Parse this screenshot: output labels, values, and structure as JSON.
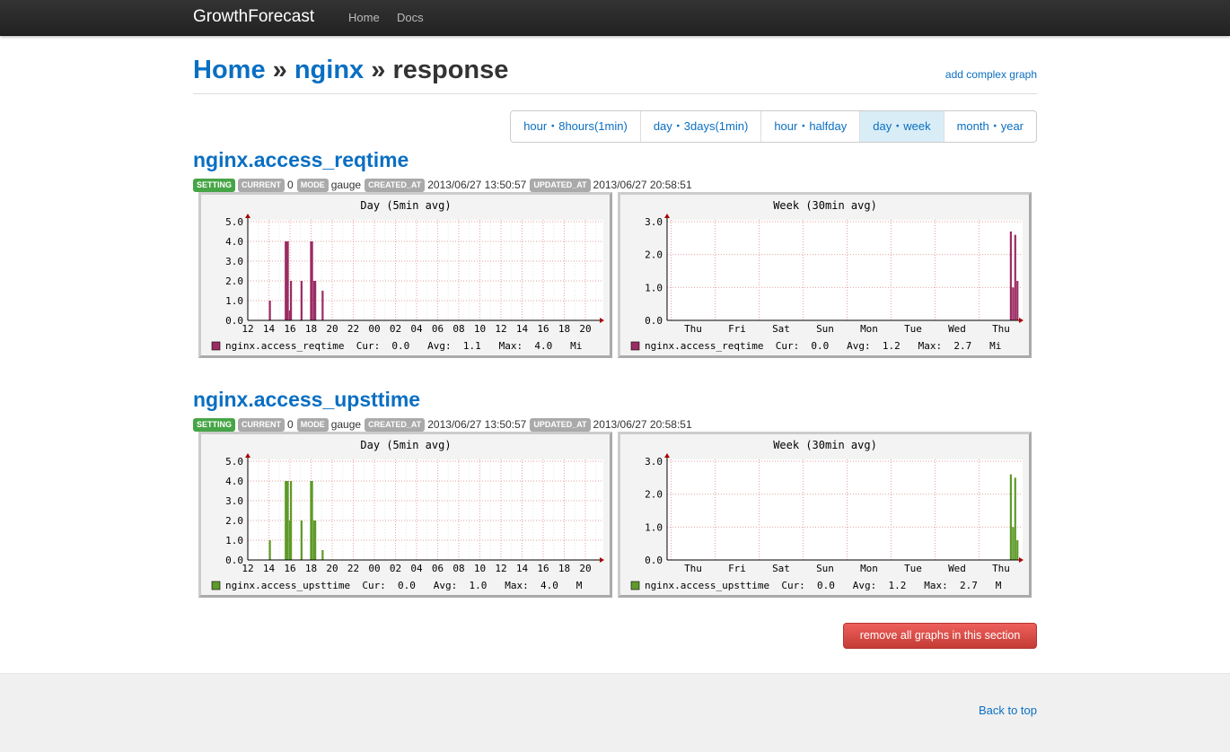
{
  "navbar": {
    "brand": "GrowthForecast",
    "links": [
      "Home",
      "Docs"
    ]
  },
  "header": {
    "crumbs": [
      "Home",
      "nginx",
      "response"
    ],
    "separator": "»",
    "add_link": "add complex graph"
  },
  "period_tabs": [
    {
      "label": "hour・8hours(1min)",
      "active": false
    },
    {
      "label": "day・3days(1min)",
      "active": false
    },
    {
      "label": "hour・halfday",
      "active": false
    },
    {
      "label": "day・week",
      "active": true
    },
    {
      "label": "month・year",
      "active": false
    }
  ],
  "graphs": [
    {
      "title": "nginx.access_reqtime",
      "labels": {
        "setting": "SETTING",
        "current": "CURRENT",
        "mode": "MODE",
        "created": "CREATED_AT",
        "updated": "UPDATED_AT"
      },
      "current": "0",
      "mode": "gauge",
      "created_at": "2013/06/27 13:50:57",
      "updated_at": "2013/06/27 20:58:51",
      "color": "#9b2c63"
    },
    {
      "title": "nginx.access_upsttime",
      "labels": {
        "setting": "SETTING",
        "current": "CURRENT",
        "mode": "MODE",
        "created": "CREATED_AT",
        "updated": "UPDATED_AT"
      },
      "current": "0",
      "mode": "gauge",
      "created_at": "2013/06/27 13:50:57",
      "updated_at": "2013/06/27 20:58:51",
      "color": "#5f9a2a"
    }
  ],
  "chart_data": [
    {
      "type": "area",
      "title": "Day (5min avg)",
      "series": [
        {
          "name": "nginx.access_reqtime"
        }
      ],
      "x_ticks": [
        "12",
        "14",
        "16",
        "18",
        "20",
        "22",
        "00",
        "02",
        "04",
        "06",
        "08",
        "10",
        "12",
        "14",
        "16",
        "18",
        "20"
      ],
      "y_ticks": [
        "0.0",
        "1.0",
        "2.0",
        "3.0",
        "4.0",
        "5.0"
      ],
      "ylim": [
        0,
        5
      ],
      "points": [
        [
          14.0,
          1.0
        ],
        [
          15.5,
          4.0
        ],
        [
          15.6,
          4.0
        ],
        [
          15.7,
          4.0
        ],
        [
          15.9,
          0.5
        ],
        [
          16.0,
          2.0
        ],
        [
          17.0,
          2.0
        ],
        [
          17.9,
          4.0
        ],
        [
          18.0,
          4.0
        ],
        [
          18.2,
          2.0
        ],
        [
          18.3,
          2.0
        ],
        [
          19.0,
          1.5
        ]
      ],
      "legend": "nginx.access_reqtime  Cur:  0.0   Avg:  1.1   Max:  4.0   Mi"
    },
    {
      "type": "area",
      "title": "Week (30min avg)",
      "series": [
        {
          "name": "nginx.access_reqtime"
        }
      ],
      "x_ticks": [
        "Thu",
        "Fri",
        "Sat",
        "Sun",
        "Mon",
        "Tue",
        "Wed",
        "Thu"
      ],
      "y_ticks": [
        "0.0",
        "1.0",
        "2.0",
        "3.0"
      ],
      "ylim": [
        0,
        3
      ],
      "points": [
        [
          7.2,
          2.7
        ],
        [
          7.25,
          1.0
        ],
        [
          7.3,
          2.6
        ],
        [
          7.35,
          1.2
        ]
      ],
      "legend": "nginx.access_reqtime  Cur:  0.0   Avg:  1.2   Max:  2.7   Mi"
    },
    {
      "type": "area",
      "title": "Day (5min avg)",
      "series": [
        {
          "name": "nginx.access_upsttime"
        }
      ],
      "x_ticks": [
        "12",
        "14",
        "16",
        "18",
        "20",
        "22",
        "00",
        "02",
        "04",
        "06",
        "08",
        "10",
        "12",
        "14",
        "16",
        "18",
        "20"
      ],
      "y_ticks": [
        "0.0",
        "1.0",
        "2.0",
        "3.0",
        "4.0",
        "5.0"
      ],
      "ylim": [
        0,
        5
      ],
      "points": [
        [
          14.0,
          1.0
        ],
        [
          15.5,
          4.0
        ],
        [
          15.6,
          4.0
        ],
        [
          15.7,
          4.0
        ],
        [
          15.9,
          2.0
        ],
        [
          16.0,
          4.0
        ],
        [
          17.0,
          2.0
        ],
        [
          17.9,
          4.0
        ],
        [
          18.0,
          4.0
        ],
        [
          18.2,
          2.0
        ],
        [
          18.3,
          2.0
        ],
        [
          19.0,
          0.5
        ]
      ],
      "legend": "nginx.access_upsttime  Cur:  0.0   Avg:  1.0   Max:  4.0   M"
    },
    {
      "type": "area",
      "title": "Week (30min avg)",
      "series": [
        {
          "name": "nginx.access_upsttime"
        }
      ],
      "x_ticks": [
        "Thu",
        "Fri",
        "Sat",
        "Sun",
        "Mon",
        "Tue",
        "Wed",
        "Thu"
      ],
      "y_ticks": [
        "0.0",
        "1.0",
        "2.0",
        "3.0"
      ],
      "ylim": [
        0,
        3
      ],
      "points": [
        [
          7.2,
          2.6
        ],
        [
          7.25,
          1.0
        ],
        [
          7.3,
          2.5
        ],
        [
          7.35,
          0.6
        ]
      ],
      "legend": "nginx.access_upsttime  Cur:  0.0   Avg:  1.2   Max:  2.7   M"
    }
  ],
  "remove_button": "remove all graphs in this section",
  "footer": {
    "back_to_top": "Back to top"
  }
}
